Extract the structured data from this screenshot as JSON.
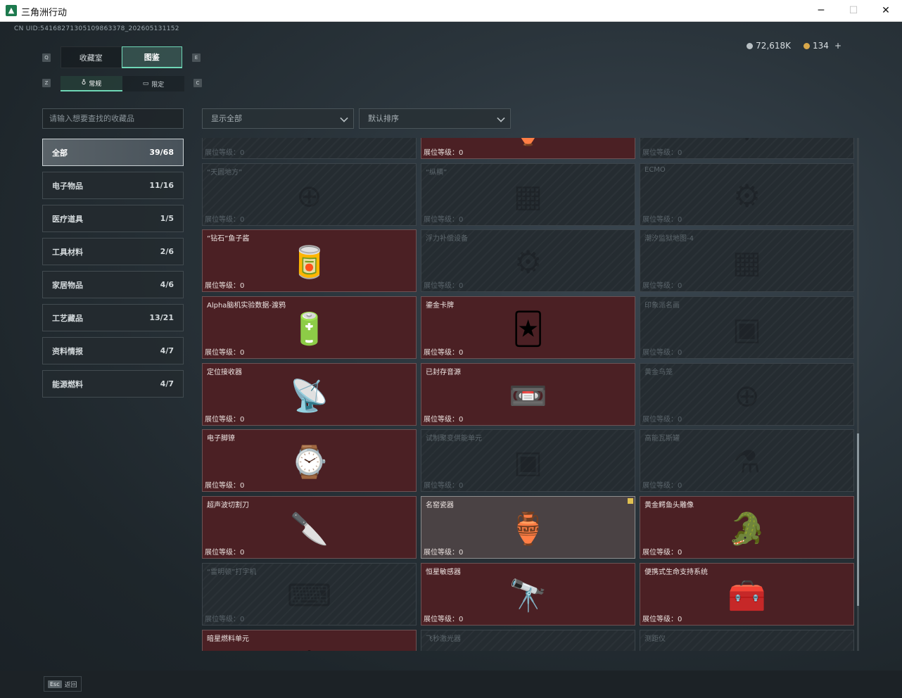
{
  "window": {
    "title": "三角洲行动",
    "min": "─",
    "max": "☐",
    "close": "✕"
  },
  "uid": "CN UID:541682713051098633​78_202605131152",
  "tabs": [
    {
      "label": "收藏室",
      "active": false
    },
    {
      "label": "图鉴",
      "active": true
    }
  ],
  "subtabs": [
    {
      "label": "常规",
      "icon": "♁",
      "active": true
    },
    {
      "label": "限定",
      "icon": "▭",
      "active": false
    }
  ],
  "keyhints": {
    "q": "Q",
    "e": "E",
    "z": "Z",
    "c": "C"
  },
  "currency": {
    "silver": "72,618K",
    "gold": "134",
    "plus": "+"
  },
  "search": {
    "placeholder": "请输入想要查找的收藏品"
  },
  "filter": {
    "value": "显示全部"
  },
  "sort": {
    "value": "默认排序"
  },
  "categories": [
    {
      "label": "全部",
      "count": "39/68",
      "active": true
    },
    {
      "label": "电子物品",
      "count": "11/16"
    },
    {
      "label": "医疗道具",
      "count": "1/5"
    },
    {
      "label": "工具材料",
      "count": "2/6"
    },
    {
      "label": "家居物品",
      "count": "4/6"
    },
    {
      "label": "工艺藏品",
      "count": "13/21"
    },
    {
      "label": "资料情报",
      "count": "4/7"
    },
    {
      "label": "能源燃料",
      "count": "4/7"
    }
  ],
  "level_label": "展位等级：",
  "items": [
    {
      "name": "",
      "level": "0",
      "owned": false,
      "icon": "⚙"
    },
    {
      "name": "",
      "level": "0",
      "owned": true,
      "icon": "🏺"
    },
    {
      "name": "",
      "level": "0",
      "owned": false,
      "icon": "⚙"
    },
    {
      "name": "“天圆地方”",
      "level": "0",
      "owned": false,
      "icon": "⊕"
    },
    {
      "name": "“纵横”",
      "level": "0",
      "owned": false,
      "icon": "▦"
    },
    {
      "name": "ECMO",
      "level": "0",
      "owned": false,
      "icon": "⚙"
    },
    {
      "name": "“钻石”鱼子酱",
      "level": "0",
      "owned": true,
      "icon": "🥫"
    },
    {
      "name": "浮力补偿设备",
      "level": "0",
      "owned": false,
      "icon": "⚙"
    },
    {
      "name": "潮汐监狱地图-4",
      "level": "0",
      "owned": false,
      "icon": "▦"
    },
    {
      "name": "Alpha脑机实验数据-渡鸦",
      "level": "0",
      "owned": true,
      "icon": "🔋"
    },
    {
      "name": "鎏金卡牌",
      "level": "0",
      "owned": true,
      "icon": "🃏"
    },
    {
      "name": "印象派名画",
      "level": "0",
      "owned": false,
      "icon": "▣"
    },
    {
      "name": "定位接收器",
      "level": "0",
      "owned": true,
      "icon": "📡"
    },
    {
      "name": "已封存音源",
      "level": "0",
      "owned": true,
      "icon": "📼"
    },
    {
      "name": "黄金鸟笼",
      "level": "0",
      "owned": false,
      "icon": "⊕"
    },
    {
      "name": "电子脚镣",
      "level": "0",
      "owned": true,
      "icon": "⌚"
    },
    {
      "name": "试制聚变供能单元",
      "level": "0",
      "owned": false,
      "icon": "▣"
    },
    {
      "name": "高能瓦斯罐",
      "level": "0",
      "owned": false,
      "icon": "⚗"
    },
    {
      "name": "超声波切割刀",
      "level": "0",
      "owned": true,
      "icon": "🔪"
    },
    {
      "name": "名窑瓷器",
      "level": "0",
      "owned": true,
      "icon": "🏺",
      "special": true
    },
    {
      "name": "黄金鳄鱼头雕像",
      "level": "0",
      "owned": true,
      "icon": "🐊"
    },
    {
      "name": "“雷明顿”打字机",
      "level": "0",
      "owned": false,
      "icon": "⌨"
    },
    {
      "name": "恒星敏感器",
      "level": "0",
      "owned": true,
      "icon": "🔭"
    },
    {
      "name": "便携式生命支持系统",
      "level": "0",
      "owned": true,
      "icon": "🧰"
    },
    {
      "name": "暗星燃料单元",
      "level": "",
      "owned": true,
      "icon": "⚙"
    },
    {
      "name": "飞秒激光器",
      "level": "",
      "owned": false,
      "icon": "⚙"
    },
    {
      "name": "测距仪",
      "level": "",
      "owned": false,
      "icon": "⚙"
    }
  ],
  "footer": {
    "key": "Esc",
    "label": "返回"
  },
  "colors": {
    "accent": "#6fd7b6",
    "owned_bg": "#4b2024",
    "locked_bg": "#252c31"
  }
}
